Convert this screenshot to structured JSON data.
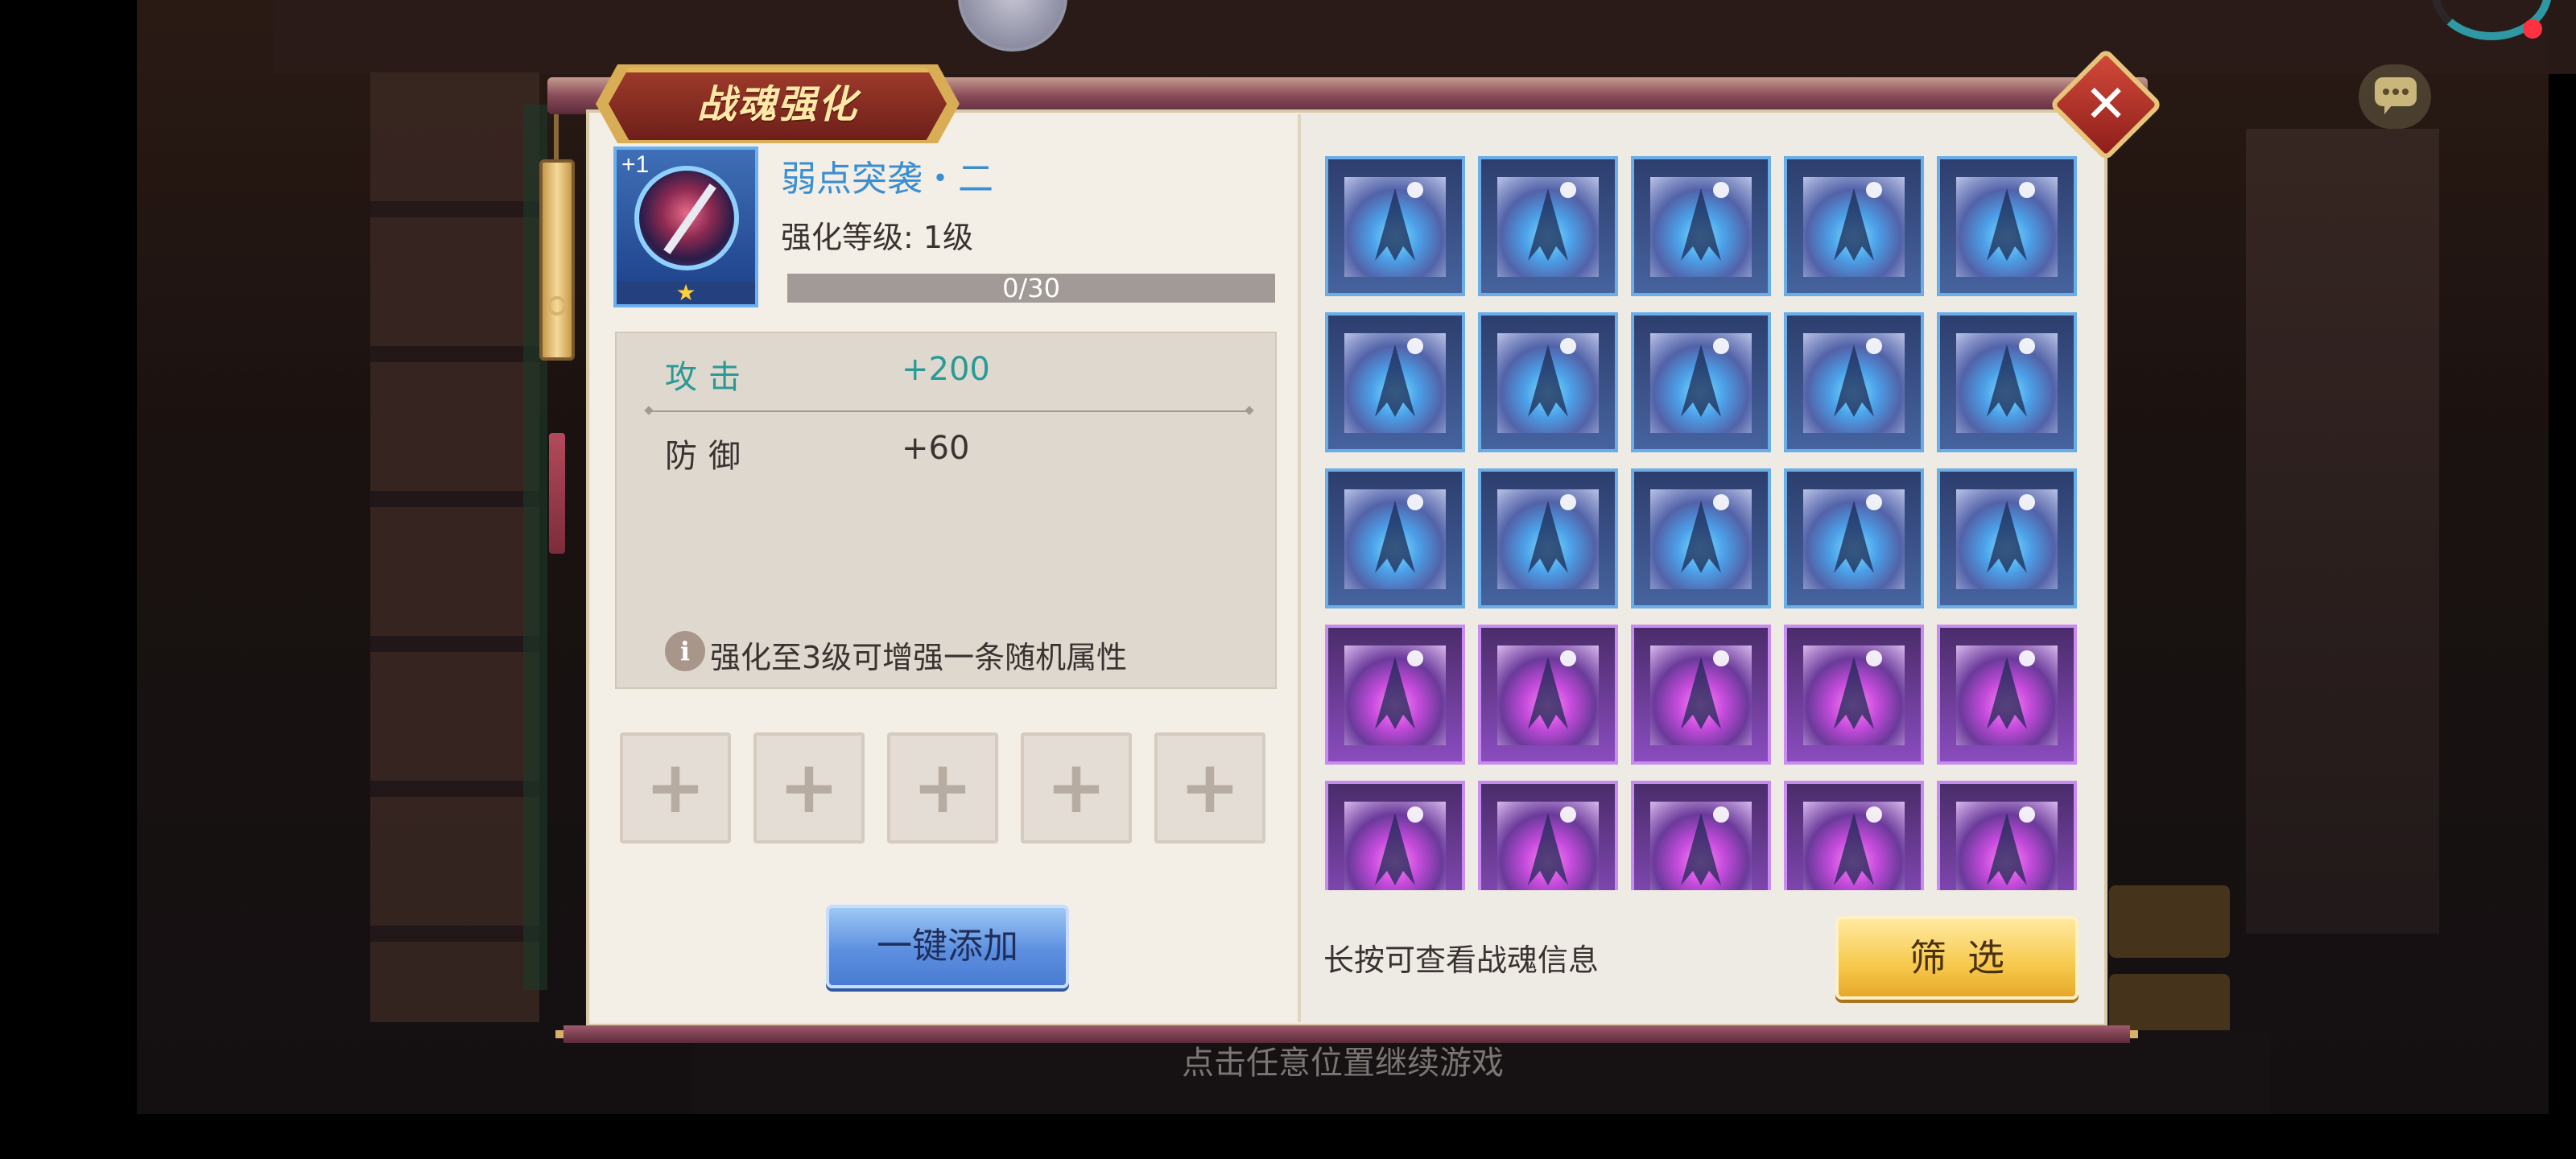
{
  "dialog": {
    "title": "战魂强化",
    "close_icon": "close-icon"
  },
  "item": {
    "name": "弱点突袭・二",
    "plus_badge": "+1",
    "star": "★",
    "level_label": "强化等级: 1级",
    "progress_text": "0/30",
    "progress_fraction": 0
  },
  "stats": [
    {
      "name": "攻击",
      "value": "+200",
      "color": "#2a9a96"
    },
    {
      "name": "防御",
      "value": "+60",
      "color": "#3a3230"
    }
  ],
  "hint": {
    "icon_glyph": "i",
    "text": "强化至3级可增强一条随机属性"
  },
  "add_slots": {
    "glyph": "+",
    "count": 5
  },
  "one_click_add_label": "一键添加",
  "gems": {
    "rows": [
      "blue",
      "blue",
      "blue",
      "purple",
      "purple"
    ],
    "columns": 5
  },
  "longpress_hint": "长按可查看战魂信息",
  "filter_label": "筛选",
  "continue_text": "点击任意位置继续游戏"
}
